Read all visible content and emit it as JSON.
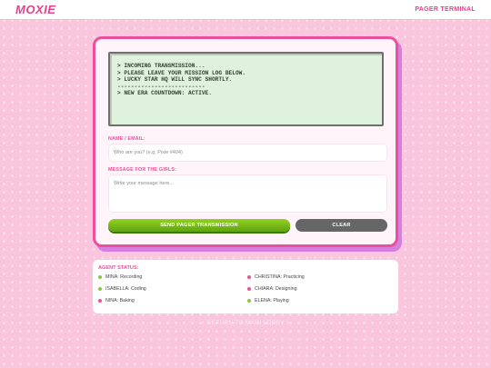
{
  "header": {
    "logo": "MOXIE",
    "nav_link": "PAGER TERMINAL"
  },
  "terminal": {
    "lines": [
      "> INCOMING TRANSMISSION...",
      "> PLEASE LEAVE YOUR MISSION LOG BELOW.",
      "> LUCKY STAR HQ WILL SYNC SHORTLY.",
      "--------------------------",
      "> NEW ERA COUNTDOWN: ACTIVE."
    ]
  },
  "form": {
    "name_label": "NAME / EMAIL:",
    "name_placeholder": "Who are you? (e.g. Pixie #404)",
    "message_label": "MESSAGE FOR THE GIRLS:",
    "message_placeholder": "Write your message here...",
    "send_label": "SEND PAGER TRANSMISSION",
    "clear_label": "CLEAR"
  },
  "agent_status": {
    "title": "AGENT STATUS:",
    "agents": [
      {
        "text": "MINA: Recording",
        "dot_color": "#8cc63f"
      },
      {
        "text": "CHRISTINA: Practicing",
        "dot_color": "#ec4f9b"
      },
      {
        "text": "ISABELLA: Coding",
        "dot_color": "#8cc63f"
      },
      {
        "text": "CHIARA: Designing",
        "dot_color": "#ec4f9b"
      },
      {
        "text": "NINA: Baking",
        "dot_color": "#ec4f9b"
      },
      {
        "text": "ELENA: Playing",
        "dot_color": "#8cc63f"
      }
    ]
  },
  "footer": {
    "return_link": "< RETURN TO MAIN LOBBY >"
  },
  "colors": {
    "accent": "#ec4f9b",
    "send_button": "#7bbf1a",
    "clear_button": "#666666",
    "terminal_bg": "#dff3dc"
  }
}
